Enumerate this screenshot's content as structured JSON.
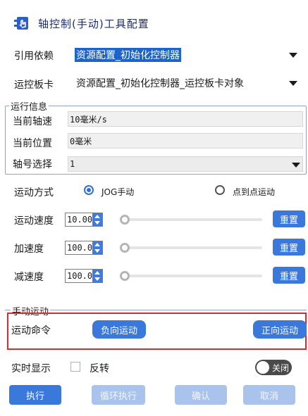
{
  "title": "轴控制(手动)工具配置",
  "reference": {
    "label": "引用依赖",
    "value": "资源配置_初始化控制器"
  },
  "motion_card": {
    "label": "运控板卡",
    "value": "资源配置_初始化控制器_运控板卡对象"
  },
  "run_info": {
    "title": "运行信息",
    "axis_speed": {
      "label": "当前轴速",
      "value": "10毫米/s"
    },
    "position": {
      "label": "当前位置",
      "value": "0毫米"
    },
    "axis_select": {
      "label": "轴号选择",
      "value": "1"
    }
  },
  "motion_mode": {
    "label": "运动方式",
    "options": [
      "JOG手动",
      "点到点运动"
    ],
    "selected": "JOG手动"
  },
  "speed": {
    "label": "运动速度",
    "value": "10.00",
    "reset": "重置"
  },
  "accel": {
    "label": "加速度",
    "value": "100.0",
    "reset": "重置"
  },
  "decel": {
    "label": "减速度",
    "value": "100.0",
    "reset": "重置"
  },
  "manual": {
    "title": "手动运动",
    "cmd_label": "运动命令",
    "negative": "负向运动",
    "positive": "正向运动",
    "highlight_color": "#e0282f"
  },
  "realtime": {
    "label": "实时显示",
    "invert": "反转",
    "toggle": "关闭"
  },
  "footer": {
    "execute": "执行",
    "loop": "循环执行",
    "confirm": "确认",
    "cancel": "取消"
  },
  "colors": {
    "accent": "#3b78dc",
    "title": "#1f2f6e",
    "selection": "#1e64c8"
  }
}
